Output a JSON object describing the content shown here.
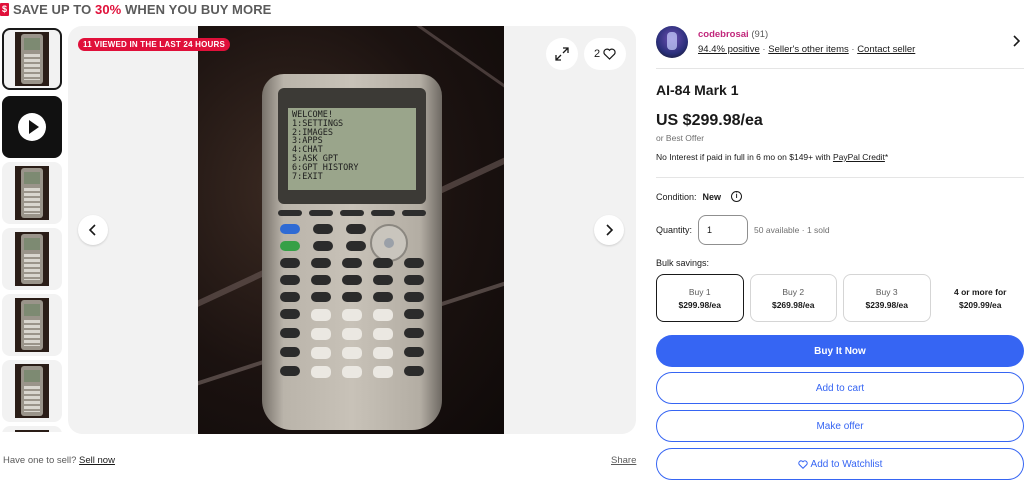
{
  "promo": {
    "prefix": "SAVE UP TO ",
    "highlight": "30%",
    "suffix": " WHEN YOU BUY MORE",
    "icon_glyph": "$",
    "icon_color": "#e0103a"
  },
  "gallery": {
    "viewed_badge": "11 VIEWED IN THE LAST 24 HOURS",
    "watch_count": "2",
    "screen_text": "WELCOME!\n1:SETTINGS\n2:IMAGES\n3:APPS\n4:CHAT\n5:ASK GPT\n6:GPT HISTORY\n7:EXIT",
    "thumbnails": [
      "image",
      "video",
      "image",
      "image",
      "image",
      "image",
      "image"
    ]
  },
  "sell": {
    "question": "Have one to sell? ",
    "link": "Sell now"
  },
  "share": "Share",
  "seller": {
    "name": "codebrosai",
    "feedback_count": "(91)",
    "positive": "94.4% positive",
    "other_items": "Seller's other items",
    "contact": "Contact seller",
    "separator": " · "
  },
  "listing": {
    "title": "AI-84 Mark 1",
    "price": "US $299.98/ea",
    "best_offer": "or Best Offer",
    "credit_text": "No Interest if paid in full in 6 mo on $149+ with ",
    "credit_link": "PayPal Credit",
    "credit_suffix": "*"
  },
  "condition": {
    "label": "Condition:",
    "value": "New"
  },
  "quantity": {
    "label": "Quantity:",
    "value": "1",
    "available": "50 available · 1 sold"
  },
  "bulk": {
    "label": "Bulk savings:",
    "options": [
      {
        "name": "Buy 1",
        "price": "$299.98/ea"
      },
      {
        "name": "Buy 2",
        "price": "$269.98/ea"
      },
      {
        "name": "Buy 3",
        "price": "$239.98/ea"
      },
      {
        "name": "4 or more for",
        "price": "$209.99/ea"
      }
    ]
  },
  "actions": {
    "buy_now": "Buy It Now",
    "add_to_cart": "Add to cart",
    "make_offer": "Make offer",
    "add_to_watchlist": "Add to Watchlist"
  },
  "colors": {
    "primary_blue": "#3665f3",
    "alert_red": "#e0103a",
    "seller_name": "#c1277b"
  }
}
